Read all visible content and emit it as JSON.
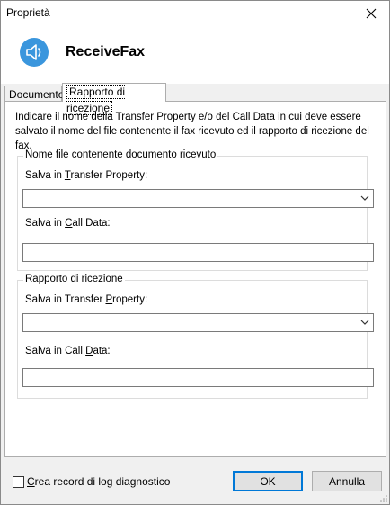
{
  "window": {
    "title": "Proprietà",
    "app_name": "ReceiveFax"
  },
  "tabs": [
    {
      "label": "Documento",
      "active": false
    },
    {
      "label": "Rapporto di ricezione",
      "active": true
    }
  ],
  "panel": {
    "description": "Indicare il nome della Transfer Property e/o del Call Data in cui deve essere salvato il nome del file contenente il fax ricevuto ed il rapporto di ricezione del fax.",
    "group1": {
      "title": "Nome file contenente documento ricevuto",
      "transfer_label_pre": "Salva in ",
      "transfer_label_ul": "T",
      "transfer_label_post": "ransfer Property:",
      "transfer_value": "",
      "calldata_label_pre": "Salva in ",
      "calldata_label_ul": "C",
      "calldata_label_post": "all Data:",
      "calldata_value": ""
    },
    "group2": {
      "title": "Rapporto di ricezione",
      "transfer_label_pre": "Salva in Transfer ",
      "transfer_label_ul": "P",
      "transfer_label_post": "roperty:",
      "transfer_value": "",
      "calldata_label_pre": "Salva in Call ",
      "calldata_label_ul": "D",
      "calldata_label_post": "ata:",
      "calldata_value": ""
    }
  },
  "footer": {
    "log_checkbox_ul": "C",
    "log_checkbox_post": "rea record di log diagnostico",
    "log_checked": false,
    "ok_label": "OK",
    "cancel_label": "Annulla"
  },
  "colors": {
    "accent": "#0078d7",
    "icon": "#3a96dd"
  }
}
